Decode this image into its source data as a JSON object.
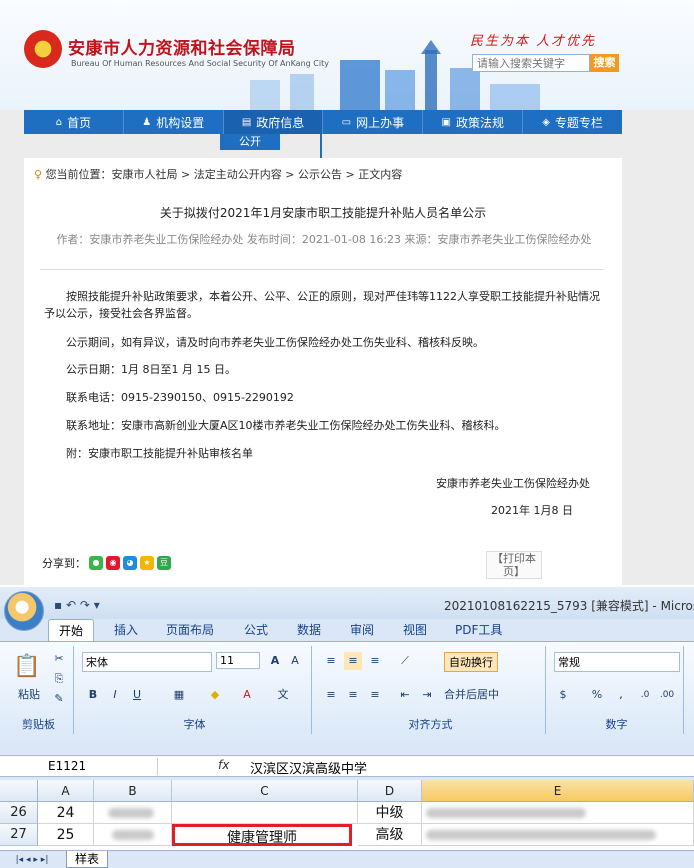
{
  "site": {
    "name": "安康市人力资源和社会保障局",
    "name_en": "Bureau Of Human Resources And Social Security Of AnKang City",
    "slogan": "民生为本  人才优先",
    "search_placeholder": "请输入搜索关键字",
    "search_button": "搜索"
  },
  "nav": {
    "items": [
      {
        "label": "首页",
        "icon": "home-icon",
        "glyph": "⌂"
      },
      {
        "label": "机构设置",
        "icon": "org-icon",
        "glyph": "♟"
      },
      {
        "label": "政府信息",
        "icon": "doc-icon",
        "glyph": "▤"
      },
      {
        "label": "网上办事",
        "icon": "monitor-icon",
        "glyph": "▭"
      },
      {
        "label": "政策法规",
        "icon": "book-icon",
        "glyph": "▣"
      },
      {
        "label": "专题专栏",
        "icon": "layers-icon",
        "glyph": "◈"
      }
    ],
    "sub": "公开"
  },
  "article": {
    "breadcrumb": "您当前位置：安康市人社局 > 法定主动公开内容 > 公示公告 > 正文内容",
    "title": "关于拟拨付2021年1月安康市职工技能提升补贴人员名单公示",
    "meta": "作者：安康市养老失业工伤保险经办处  发布时间：2021-01-08 16:23  来源：安康市养老失业工伤保险经办处",
    "paragraphs": [
      "按照技能提升补贴政策要求，本着公开、公平、公正的原则，现对严佳玮等1122人享受职工技能提升补贴情况予以公示，接受社会各界监督。",
      "公示期间，如有异议，请及时向市养老失业工伤保险经办处工伤失业科、稽核科反映。",
      "公示日期：1月 8日至1 月 15 日。",
      "联系电话：0915-2390150、0915-2290192",
      "联系地址：安康市高新创业大厦A区10楼市养老失业工伤保险经办处工伤失业科、稽核科。",
      "附：安康市职工技能提升补贴审核名单"
    ],
    "signature": "安康市养老失业工伤保险经办处",
    "date": "2021年 1月8 日",
    "share_label": "分享到：",
    "print_label": "【打印本页】"
  },
  "excel": {
    "window_title": "20210108162215_5793  [兼容模式] - Micros",
    "tabs": [
      "开始",
      "插入",
      "页面布局",
      "公式",
      "数据",
      "审阅",
      "视图",
      "PDF工具"
    ],
    "groups": [
      "剪贴板",
      "字体",
      "对齐方式",
      "数字"
    ],
    "paste_label": "粘贴",
    "font_name": "宋体",
    "font_size": "11",
    "wrap_text": "自动换行",
    "merge_center": "合并后居中",
    "number_format": "常规",
    "name_box": "E1121",
    "fx": "fx",
    "formula_value": "汉滨区汉滨高级中学",
    "columns": [
      "A",
      "B",
      "C",
      "D",
      "E"
    ],
    "rows": [
      {
        "num": "26",
        "a": "24",
        "c": "",
        "d": "中级"
      },
      {
        "num": "27",
        "a": "25",
        "c": "健康管理师",
        "d": "高级"
      }
    ],
    "sheet_tab": "样表"
  }
}
